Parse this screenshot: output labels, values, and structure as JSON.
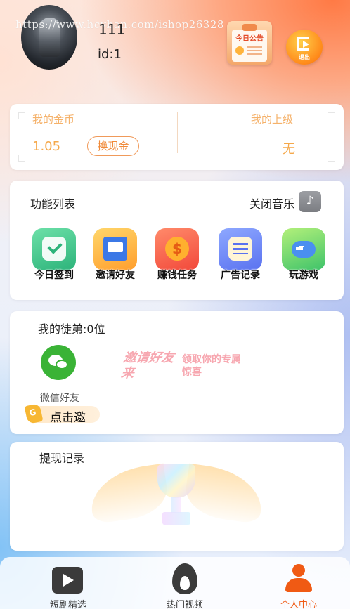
{
  "watermark": "https://www.hcyban.com/ishop26328",
  "profile": {
    "username": "111",
    "user_id": "id:1"
  },
  "header": {
    "notice_label": "今日公告",
    "logout_label": "退出"
  },
  "coins": {
    "label": "我的金币",
    "value": "1.05",
    "cash_button": "换现金",
    "superior_label": "我的上级",
    "superior_value": "无"
  },
  "functions": {
    "title": "功能列表",
    "music_toggle": "关闭音乐",
    "items": [
      {
        "label": "今日签到",
        "icon": "calendar-check-icon"
      },
      {
        "label": "邀请好友",
        "icon": "invite-letter-icon"
      },
      {
        "label": "赚钱任务",
        "icon": "money-coin-icon"
      },
      {
        "label": "广告记录",
        "icon": "ad-record-icon"
      },
      {
        "label": "玩游戏",
        "icon": "gamepad-icon"
      }
    ]
  },
  "disciples": {
    "title": "我的徒弟:0位",
    "wechat_label": "微信好友",
    "invite_button": "点击邀",
    "promo_main": "邀请好友来",
    "promo_sub": "领取你的专属惊喜"
  },
  "withdraw": {
    "title": "提现记录"
  },
  "tabbar": {
    "items": [
      {
        "label": "短剧精选",
        "icon": "play-icon"
      },
      {
        "label": "热门视频",
        "icon": "fire-icon"
      },
      {
        "label": "个人中心",
        "icon": "user-icon"
      }
    ],
    "active_color": "#f05a14"
  },
  "colors": {
    "accent": "#f5a84a",
    "wechat": "#3ab336"
  }
}
